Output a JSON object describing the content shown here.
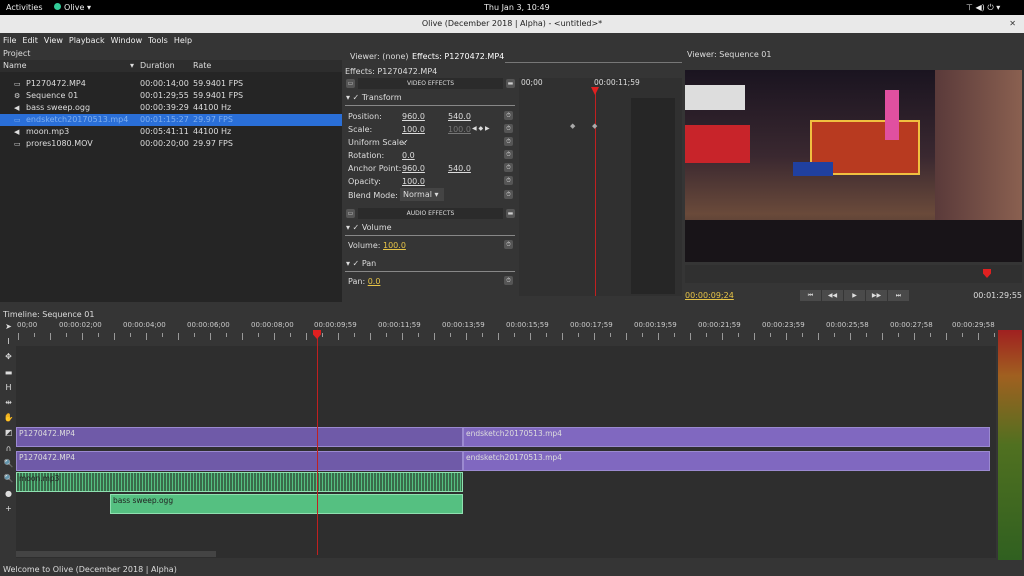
{
  "system": {
    "activities": "Activities",
    "app": "Olive ▾",
    "clock": "Thu Jan  3, 10:49",
    "tray": "⊤  ◀)  ⏻ ▾"
  },
  "window": {
    "title": "Olive (December 2018 | Alpha) - <untitled>*"
  },
  "menu": [
    "File",
    "Edit",
    "View",
    "Playback",
    "Window",
    "Tools",
    "Help"
  ],
  "project": {
    "title": "Project",
    "columns": {
      "name": "Name",
      "duration": "Duration",
      "rate": "Rate"
    },
    "items": [
      {
        "icon": "video-icon",
        "name": "P1270472.MP4",
        "duration": "00:00:14;00",
        "rate": "59.9401 FPS"
      },
      {
        "icon": "sequence-icon",
        "name": "Sequence 01",
        "duration": "00:01:29;55",
        "rate": "59.9401 FPS"
      },
      {
        "icon": "audio-icon",
        "name": "bass sweep.ogg",
        "duration": "00:00:39:29",
        "rate": "44100 Hz"
      },
      {
        "icon": "video-icon",
        "name": "endsketch20170513.mp4",
        "duration": "00:01:15:27",
        "rate": "29.97 FPS",
        "selected": true
      },
      {
        "icon": "audio-icon",
        "name": "moon.mp3",
        "duration": "00:05:41:11",
        "rate": "44100 Hz"
      },
      {
        "icon": "video-icon",
        "name": "prores1080.MOV",
        "duration": "00:00:20;00",
        "rate": "29.97 FPS"
      }
    ]
  },
  "effects": {
    "tabs": [
      "Viewer: (none)",
      "Effects: P1270472.MP4"
    ],
    "title": "Effects: P1270472.MP4",
    "video_header": "VIDEO EFFECTS",
    "audio_header": "AUDIO EFFECTS",
    "transform": {
      "name": "Transform",
      "position_label": "Position:",
      "position_x": "960.0",
      "position_y": "540.0",
      "scale_label": "Scale:",
      "scale": "100.0",
      "scale_y": "100.0",
      "uniform_label": "Uniform Scale:",
      "uniform": "✓",
      "rotation_label": "Rotation:",
      "rotation": "0.0",
      "anchor_label": "Anchor Point:",
      "anchor_x": "960.0",
      "anchor_y": "540.0",
      "opacity_label": "Opacity:",
      "opacity": "100.0",
      "blend_label": "Blend Mode:",
      "blend": "Normal"
    },
    "volume": {
      "name": "Volume",
      "label": "Volume:",
      "value": "100.0"
    },
    "pan": {
      "name": "Pan",
      "label": "Pan:",
      "value": "0.0"
    },
    "kf_start": "00;00",
    "kf_playhead": "00:00:11;59"
  },
  "viewer": {
    "title": "Viewer: Sequence 01",
    "current": "00:00:09;24",
    "total": "00:01:29;55"
  },
  "timeline": {
    "title": "Timeline: Sequence 01",
    "ruler": [
      "00;00",
      "00:00:02;00",
      "00:00:04;00",
      "00:00:06;00",
      "00:00:08;00",
      "00:00:09;59",
      "00:00:11;59",
      "00:00:13;59",
      "00:00:15;59",
      "00:00:17;59",
      "00:00:19;59",
      "00:00:21;59",
      "00:00:23;59",
      "00:00:25;58",
      "00:00:27;58",
      "00:00:29;58"
    ],
    "clips": {
      "v1a": "P1270472.MP4",
      "v1b": "endsketch20170513.mp4",
      "v2a": "P1270472.MP4",
      "v2b": "endsketch20170513.mp4",
      "a1": "moon.mp3",
      "a2": "bass sweep.ogg"
    }
  },
  "status": "Welcome to Olive (December 2018 | Alpha)",
  "colors": {
    "selection": "#2a6fd8",
    "playhead": "#e02020",
    "video_clip": "#6f5aa8",
    "audio_clip": "#55c081",
    "value": "#e8c547"
  }
}
